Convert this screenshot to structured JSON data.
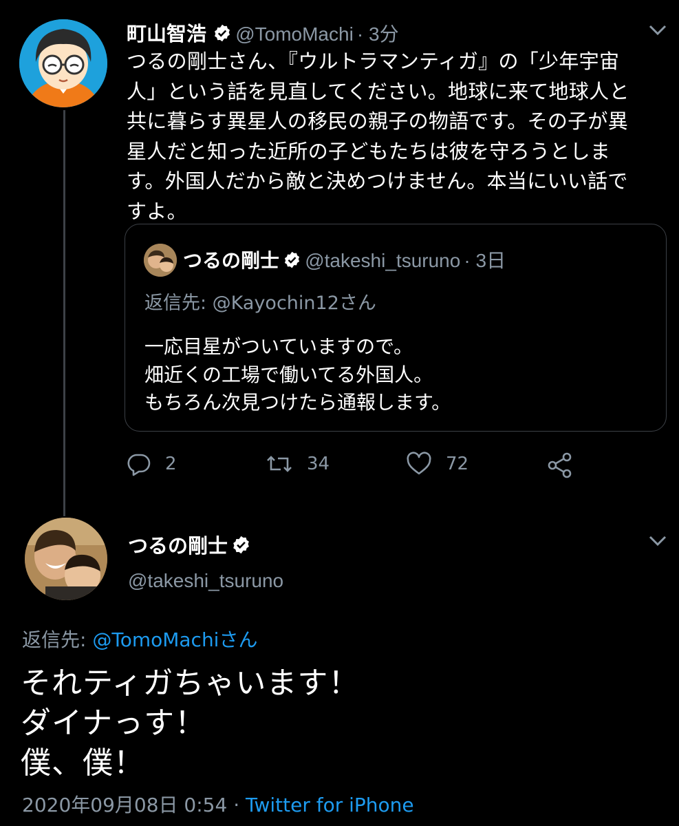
{
  "tweet1": {
    "display_name": "町山智浩",
    "handle": "@TomoMachi",
    "time": "· 3分",
    "body_lines": [
      "つるの剛士さん、『ウルトラマンティガ』の「少年宇宙",
      "人」という話を見直してください。地球に来て地球人と",
      "共に暮らす異星人の移民の親子の物語です。その子が異",
      "星人だと知った近所の子どもたちは彼を守ろうとしま",
      "す。外国人だから敵と決めつけません。本当にいい話で",
      "すよ。"
    ],
    "quote": {
      "display_name": "つるの剛士",
      "handle": "@takeshi_tsuruno",
      "time": "· 3日",
      "reply_to": "返信先: @Kayochin12さん",
      "body_lines": [
        "一応目星がついていますので。",
        "畑近くの工場で働いてる外国人。",
        "もちろん次見つけたら通報します。"
      ]
    },
    "actions": {
      "reply_count": "2",
      "retweet_count": "34",
      "like_count": "72"
    }
  },
  "tweet2": {
    "display_name": "つるの剛士",
    "handle": "@takeshi_tsuruno",
    "reply_to_prefix": "返信先: ",
    "reply_to_link": "@TomoMachiさん",
    "body_lines": [
      "それティガちゃいます！",
      "ダイナっす！",
      "僕、僕！"
    ],
    "date": "2020年09月08日 0:54",
    "separator": " · ",
    "client": "Twitter for iPhone"
  },
  "colors": {
    "background": "#000000",
    "secondary_text": "#8b98a5",
    "link": "#1d9bf0",
    "border": "#3d4147"
  },
  "icons": [
    "verified-badge-icon",
    "chevron-down-icon",
    "reply-icon",
    "retweet-icon",
    "like-icon",
    "share-icon"
  ]
}
